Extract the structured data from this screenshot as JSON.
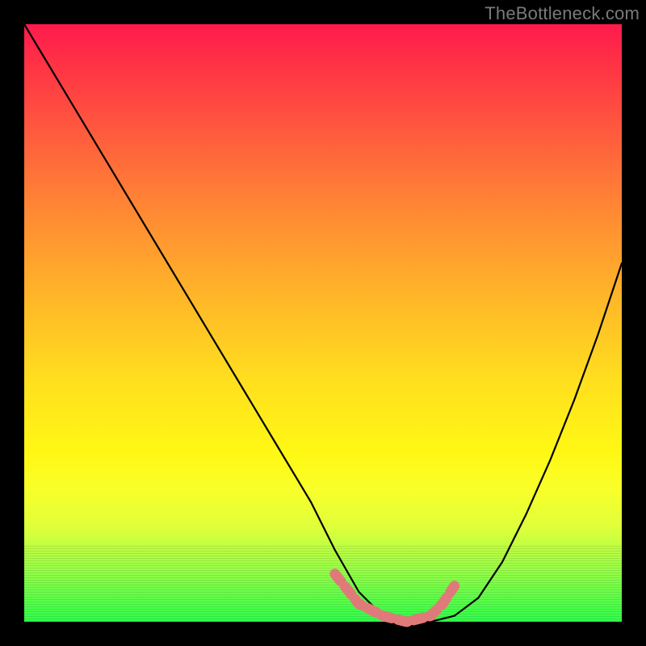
{
  "watermark": "TheBottleneck.com",
  "chart_data": {
    "type": "line",
    "title": "",
    "xlabel": "",
    "ylabel": "",
    "xlim": [
      0,
      100
    ],
    "ylim": [
      0,
      100
    ],
    "grid": false,
    "series": [
      {
        "name": "bottleneck-curve",
        "x": [
          0,
          6,
          12,
          18,
          24,
          30,
          36,
          42,
          48,
          52,
          56,
          60,
          64,
          68,
          72,
          76,
          80,
          84,
          88,
          92,
          96,
          100
        ],
        "values": [
          100,
          90,
          80,
          70,
          60,
          50,
          40,
          30,
          20,
          12,
          5,
          1,
          0,
          0,
          1,
          4,
          10,
          18,
          27,
          37,
          48,
          60
        ]
      }
    ],
    "highlight": {
      "name": "optimal-band",
      "x": [
        52,
        56,
        60,
        64,
        68,
        70,
        72
      ],
      "values": [
        8,
        3,
        1,
        0,
        1,
        3,
        6
      ],
      "color": "#e07a7a"
    },
    "background_gradient": {
      "top": "#ff1a4d",
      "mid": "#ffe800",
      "bottom": "#2eff4a"
    }
  }
}
